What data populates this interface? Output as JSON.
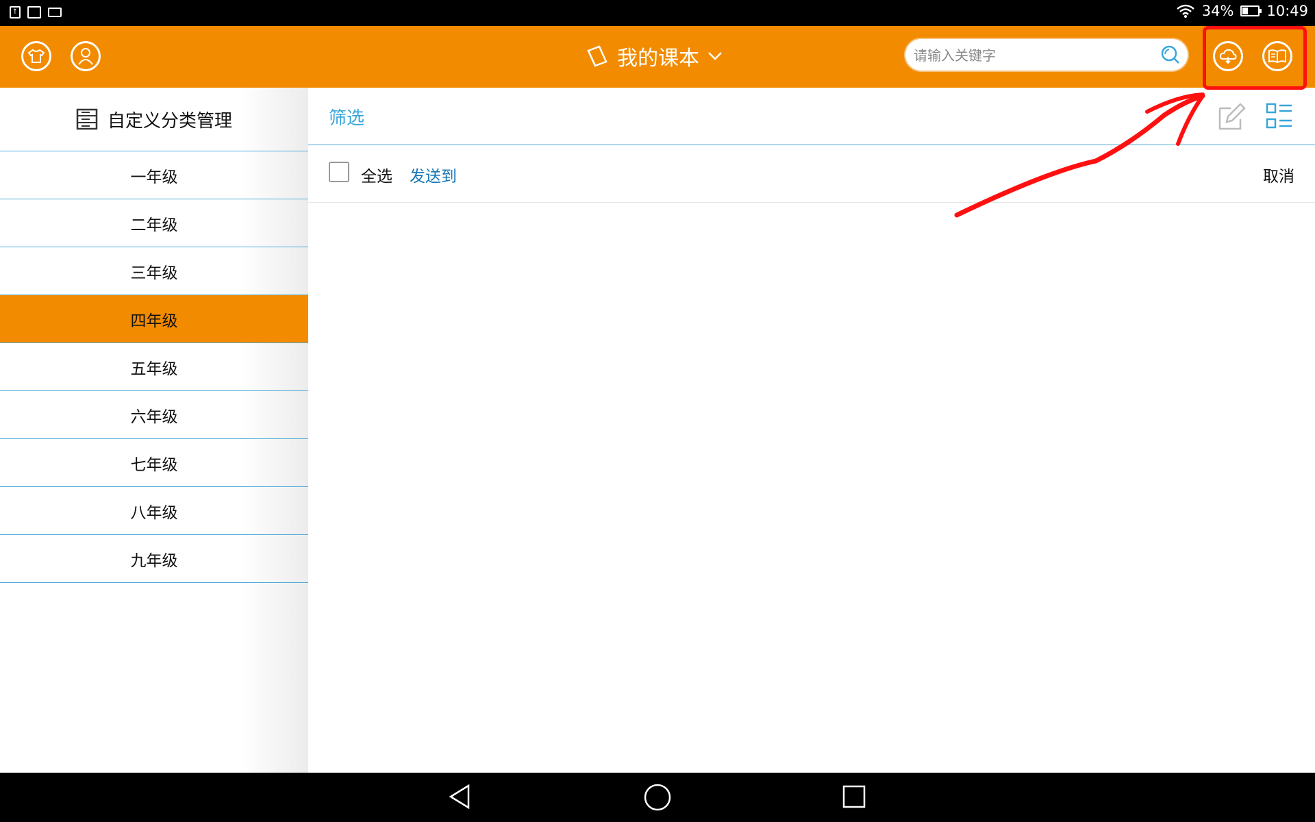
{
  "status_bar": {
    "left_icons": [
      "notification-icon",
      "image-icon",
      "keyboard-icon"
    ],
    "battery_percent": "34%",
    "battery_level": 0.34,
    "time": "10:49"
  },
  "header": {
    "title": "我的课本",
    "search_placeholder": "请输入关键字",
    "left_icons": [
      "shirt-icon",
      "user-icon"
    ],
    "right_icons": [
      "cloud-icon",
      "book-icon"
    ],
    "color": "#f28b00"
  },
  "sidebar": {
    "title": "自定义分类管理",
    "items": [
      {
        "label": "一年级",
        "active": false
      },
      {
        "label": "二年级",
        "active": false
      },
      {
        "label": "三年级",
        "active": false
      },
      {
        "label": "四年级",
        "active": true
      },
      {
        "label": "五年级",
        "active": false
      },
      {
        "label": "六年级",
        "active": false
      },
      {
        "label": "七年级",
        "active": false
      },
      {
        "label": "八年级",
        "active": false
      },
      {
        "label": "九年级",
        "active": false
      }
    ]
  },
  "main": {
    "filter_label": "筛选",
    "select_all_label": "全选",
    "send_to_label": "发送到",
    "cancel_label": "取消"
  },
  "colors": {
    "accent": "#f28b00",
    "link": "#36a6d9",
    "annotation": "#ff1010"
  }
}
